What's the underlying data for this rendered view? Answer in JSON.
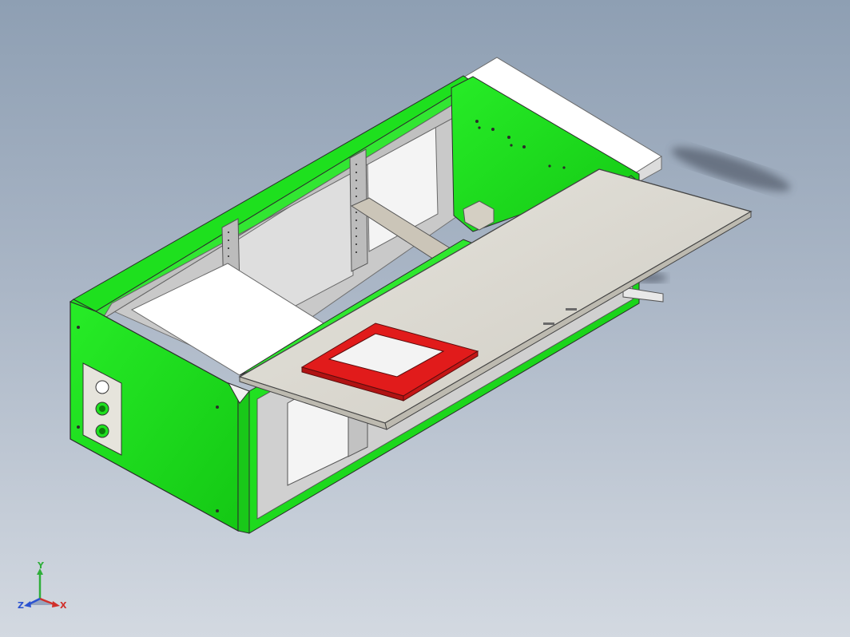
{
  "viewport": {
    "colors": {
      "enclosure": "#1ee01e",
      "cutout_frame": "#e11b1b",
      "panel": "#e0ded6",
      "background_top": "#8e9fb3",
      "background_bottom": "#d3d9e1"
    }
  },
  "triad": {
    "y_label": "Y",
    "x_label": "X",
    "z_label": "Z",
    "colors": {
      "x": "#d0302b",
      "y": "#2fae3a",
      "z": "#2b52d0"
    }
  }
}
